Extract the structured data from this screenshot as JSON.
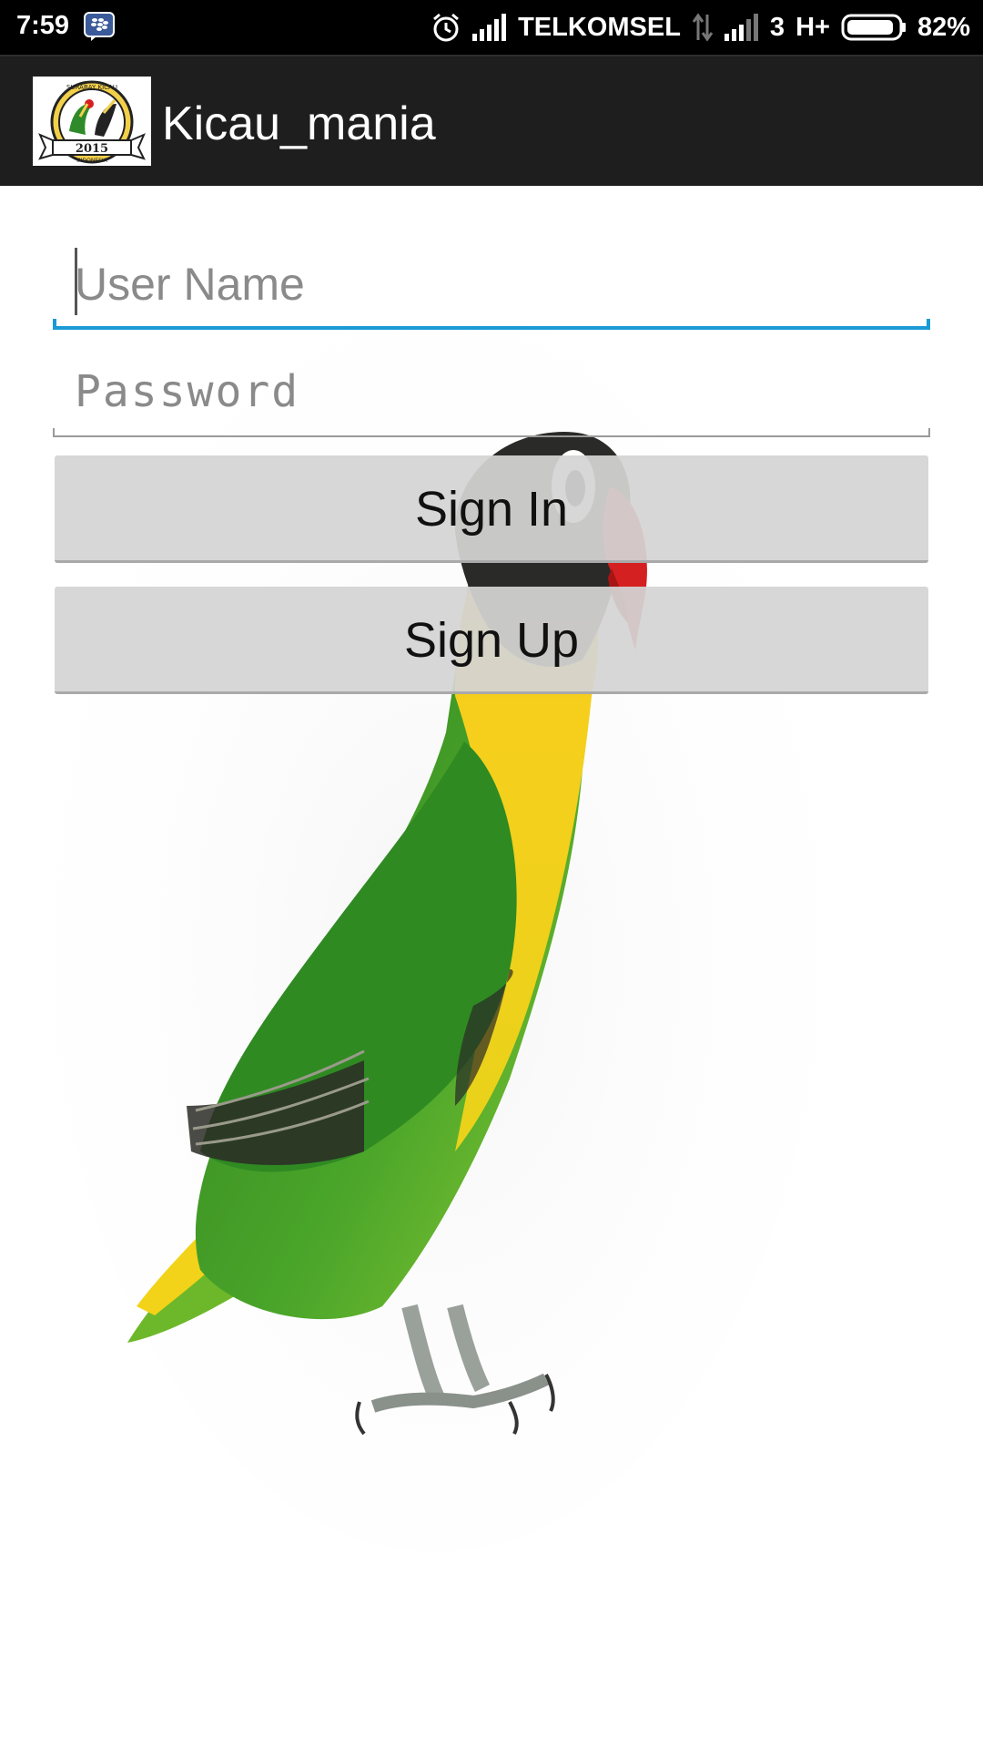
{
  "status_bar": {
    "time": "7:59",
    "carrier": "TELKOMSEL",
    "network_type": "3",
    "network_speed": "H+",
    "battery_percent": "82%",
    "icons": [
      "bbm-notification-icon",
      "alarm-icon",
      "signal-icon",
      "data-activity-icon",
      "signal-icon-2",
      "battery-icon"
    ]
  },
  "action_bar": {
    "title": "Kicau_mania",
    "logo_icon": "kicau-mania-logo",
    "logo_text": {
      "top": "SURABAY KICAU",
      "year": "2015",
      "bottom": "INDONESIA"
    }
  },
  "form": {
    "username_placeholder": "User Name",
    "password_placeholder": "Password",
    "sign_in_label": "Sign In",
    "sign_up_label": "Sign Up"
  },
  "background": {
    "image": "lovebird-parrot-illustration",
    "colors": {
      "head": "#2a2a2a",
      "beak": "#d42020",
      "neck": "#f2c418",
      "body": "#3f9a22",
      "accent": "#1a9ad6"
    }
  }
}
